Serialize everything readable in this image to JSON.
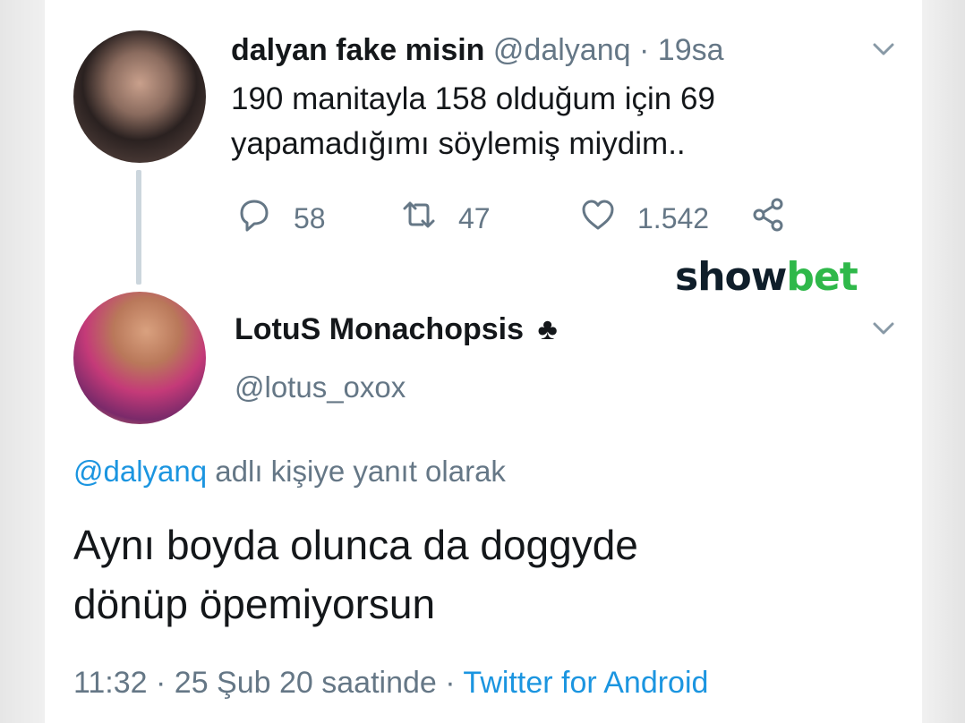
{
  "tweet1": {
    "display_name": "dalyan fake misin",
    "handle": "@dalyanq",
    "separator": "·",
    "time": "19sa",
    "text_line1": "190 manitayla 158 olduğum için 69",
    "text_line2": "yapamadığımı söylemiş miydim..",
    "replies": "58",
    "retweets": "47",
    "likes": "1.542"
  },
  "watermark": {
    "part1": "show",
    "part2": "bet"
  },
  "tweet2": {
    "display_name": "LotuS Monachopsis",
    "badge": "♣",
    "handle": "@lotus_oxox",
    "reply_mention": "@dalyanq",
    "reply_suffix": " adlı kişiye yanıt olarak",
    "text_line1": "Aynı boyda olunca da doggyde",
    "text_line2": "dönüp öpemiyorsun",
    "time": "11:32",
    "separator": " · ",
    "date": "25 Şub 20 saatinde",
    "separator2": " · ",
    "source": "Twitter for Android"
  },
  "colors": {
    "secondary_text": "#657786",
    "link_blue": "#1b95e0",
    "watermark_dark": "#0f1e2a",
    "watermark_green": "#2fb84a"
  },
  "icons": [
    "chevron-down-icon",
    "reply-icon",
    "retweet-icon",
    "like-icon",
    "share-icon",
    "club-icon"
  ]
}
